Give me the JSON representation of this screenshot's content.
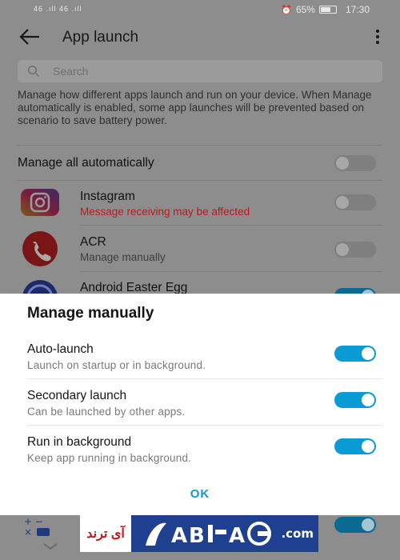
{
  "status_bar": {
    "signal_text": "46 .ıll  46 .ıll",
    "battery": "65%",
    "battery_level": 0.65,
    "time": "17:30"
  },
  "app_bar": {
    "title": "App launch",
    "back_icon": "arrow-back-icon",
    "menu_icon": "more-vert-icon"
  },
  "search": {
    "placeholder": "Search",
    "icon": "search-icon"
  },
  "description": "Manage how different apps launch and run on your device. When Manage automatically is enabled, some app launches will be prevented based on scenario to save battery power.",
  "manage_all": {
    "label": "Manage all automatically",
    "enabled": false
  },
  "apps": [
    {
      "name": "Instagram",
      "status": "Message receiving may be affected",
      "status_color": "#c0181a",
      "enabled": false,
      "icon": "instagram-icon"
    },
    {
      "name": "ACR",
      "status": "Manage manually",
      "enabled": false,
      "icon": "phone-call-icon"
    },
    {
      "name": "Android Easter Egg",
      "enabled": true,
      "icon": "easter-egg-icon"
    }
  ],
  "dialog": {
    "title": "Manage manually",
    "options": [
      {
        "label": "Auto-launch",
        "description": "Launch on startup or in background.",
        "enabled": true
      },
      {
        "label": "Secondary launch",
        "description": "Can be launched by other apps.",
        "enabled": true
      },
      {
        "label": "Run in background",
        "description": "Keep app running in background.",
        "enabled": true
      }
    ],
    "ok_label": "OK"
  },
  "watermark": {
    "left_text": "آی ترند",
    "domain": ".com"
  },
  "colors": {
    "accent": "#0a9bd5",
    "warning": "#c0181a",
    "scrim": "#8d8d8d"
  }
}
